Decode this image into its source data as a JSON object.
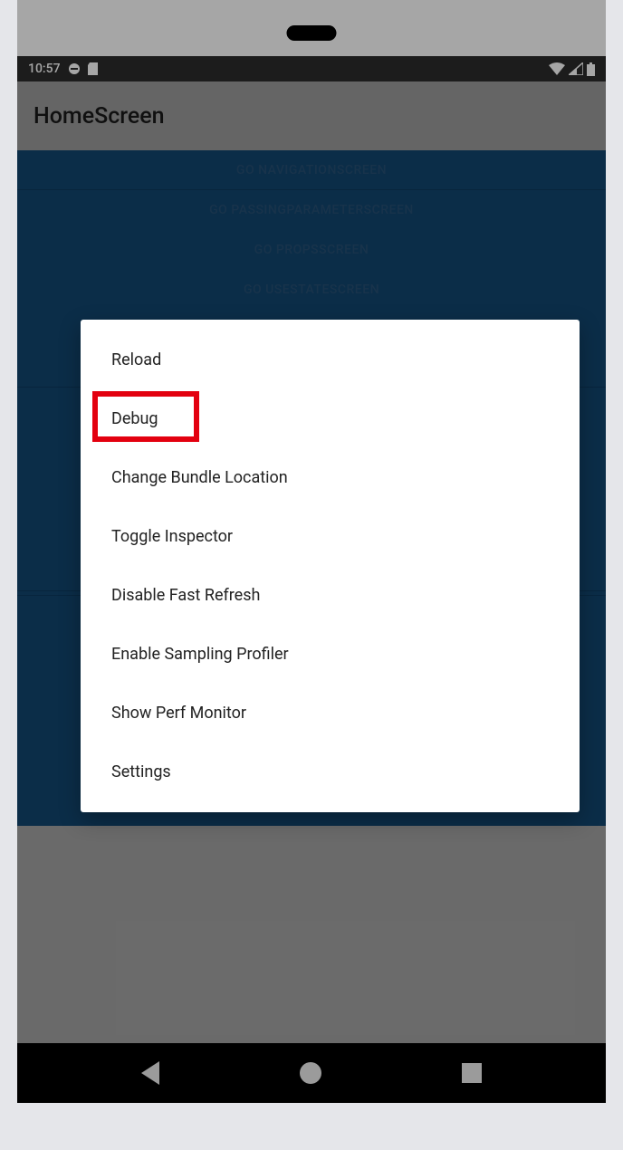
{
  "statusBar": {
    "time": "10:57"
  },
  "header": {
    "title": "HomeScreen"
  },
  "navButtons": [
    {
      "label": "GO NAVIGATIONSCREEN"
    },
    {
      "label": "GO PASSINGPARAMETERSCREEN"
    },
    {
      "label": "GO PROPSSCREEN"
    },
    {
      "label": "GO USESTATESCREEN"
    }
  ],
  "devMenu": {
    "items": [
      {
        "label": "Reload"
      },
      {
        "label": "Debug"
      },
      {
        "label": "Change Bundle Location"
      },
      {
        "label": "Toggle Inspector"
      },
      {
        "label": "Disable Fast Refresh"
      },
      {
        "label": "Enable Sampling Profiler"
      },
      {
        "label": "Show Perf Monitor"
      },
      {
        "label": "Settings"
      }
    ],
    "highlightedIndex": 1
  }
}
